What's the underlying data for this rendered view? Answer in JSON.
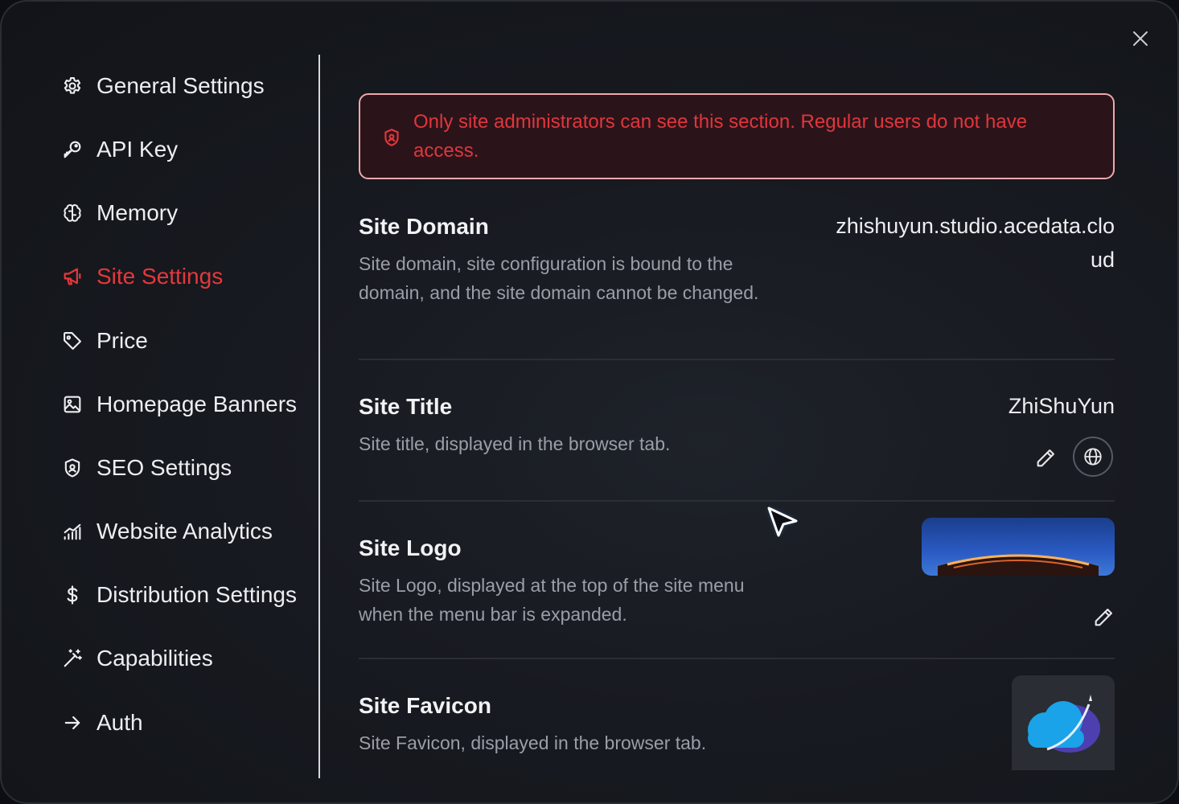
{
  "sidebar": {
    "items": [
      {
        "label": "General Settings",
        "icon": "gear-icon"
      },
      {
        "label": "API Key",
        "icon": "key-icon"
      },
      {
        "label": "Memory",
        "icon": "brain-icon"
      },
      {
        "label": "Site Settings",
        "icon": "megaphone-icon",
        "active": true
      },
      {
        "label": "Price",
        "icon": "tag-icon"
      },
      {
        "label": "Homepage Banners",
        "icon": "image-icon"
      },
      {
        "label": "SEO Settings",
        "icon": "shield-icon"
      },
      {
        "label": "Website Analytics",
        "icon": "chart-icon"
      },
      {
        "label": "Distribution Settings",
        "icon": "dollar-icon"
      },
      {
        "label": "Capabilities",
        "icon": "magic-wand-icon"
      },
      {
        "label": "Auth",
        "icon": "arrow-right-icon"
      }
    ]
  },
  "alert": {
    "text": "Only site administrators can see this section. Regular users do not have access."
  },
  "sections": {
    "domain": {
      "title": "Site Domain",
      "description": "Site domain, site configuration is bound to the domain, and the site domain cannot be changed.",
      "value_line1": "zhishuyun.studio.acedata.clo",
      "value_line2": "ud"
    },
    "title": {
      "title": "Site Title",
      "description": "Site title, displayed in the browser tab.",
      "value": "ZhiShuYun"
    },
    "logo": {
      "title": "Site Logo",
      "description": "Site Logo, displayed at the top of the site menu when the menu bar is expanded."
    },
    "favicon": {
      "title": "Site Favicon",
      "description": "Site Favicon, displayed in the browser tab."
    }
  },
  "colors": {
    "accent": "#e5383b",
    "alert_border": "#f0a8ac",
    "alert_bg": "#2a141a"
  }
}
